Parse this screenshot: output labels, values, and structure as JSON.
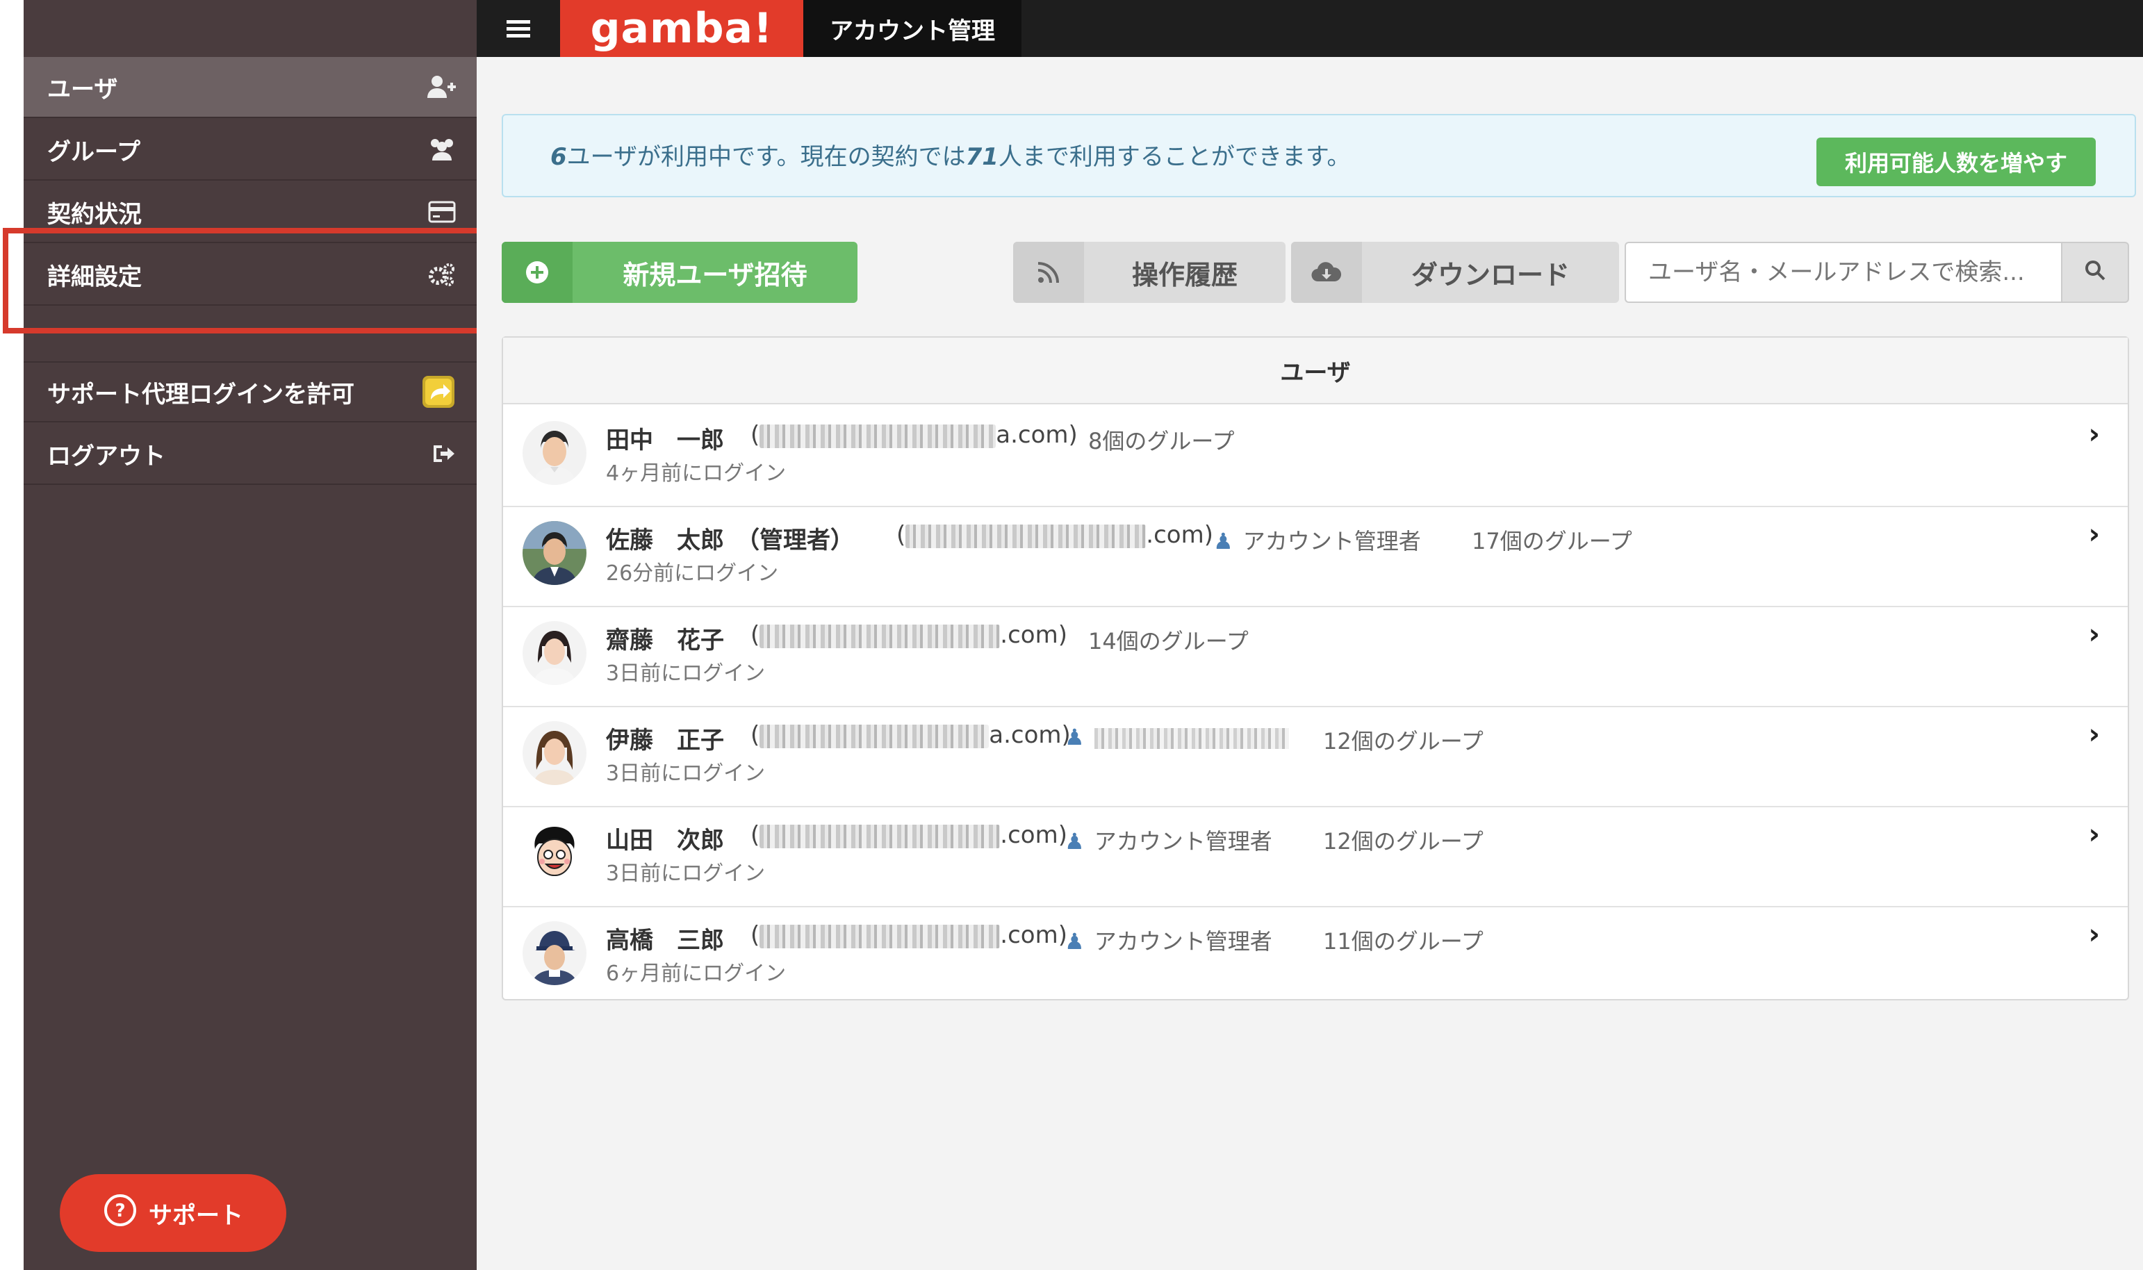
{
  "topbar": {
    "menu_icon": "hamburger-icon",
    "logo": "gamba!",
    "active_tab": "アカウント管理"
  },
  "sidebar": {
    "items": [
      {
        "label": "ユーザ",
        "icon": "user-add-icon"
      },
      {
        "label": "グループ",
        "icon": "users-icon"
      },
      {
        "label": "契約状況",
        "icon": "credit-card-icon"
      },
      {
        "label": "詳細設定",
        "icon": "gears-icon"
      },
      {
        "label": "サポート代理ログインを許可",
        "icon": "share-icon"
      },
      {
        "label": "ログアウト",
        "icon": "sign-out-icon"
      }
    ],
    "support_button": "サポート"
  },
  "info": {
    "user_count": "6",
    "text_middle": "ユーザが利用中です。現在の契約では",
    "limit": "71",
    "text_end": "人まで利用することができます。",
    "increase_button": "利用可能人数を増やす"
  },
  "actions": {
    "invite": "新規ユーザ招待",
    "history": "操作履歴",
    "download": "ダウンロード",
    "search_placeholder": "ユーザ名・メールアドレスで検索..."
  },
  "table": {
    "header": "ユーザ",
    "rows": [
      {
        "name": "田中　一郎",
        "email_suffix": "a.com)",
        "role": "",
        "groups": "8個のグループ",
        "last_login": "4ヶ月前にログイン"
      },
      {
        "name": "佐藤　太郎　（管理者）",
        "email_suffix": ".com)",
        "role": "アカウント管理者",
        "groups": "17個のグループ",
        "last_login": "26分前にログイン"
      },
      {
        "name": "齋藤　花子",
        "email_suffix": ".com)",
        "role": "",
        "groups": "14個のグループ",
        "last_login": "3日前にログイン"
      },
      {
        "name": "伊藤　正子",
        "email_suffix": "a.com)",
        "role": "アカウント管理者",
        "groups": "12個のグループ",
        "last_login": "3日前にログイン"
      },
      {
        "name": "山田　次郎",
        "email_suffix": ".com)",
        "role": "アカウント管理者",
        "groups": "12個のグループ",
        "last_login": "3日前にログイン"
      },
      {
        "name": "高橋　三郎",
        "email_suffix": ".com)",
        "role": "アカウント管理者",
        "groups": "11個のグループ",
        "last_login": "6ヶ月前にログイン"
      }
    ]
  },
  "colors": {
    "sidebar_bg": "#4a3c3e",
    "brand_red": "#e23b2a",
    "green": "#5cb85c",
    "highlight": "#d63a2c"
  }
}
